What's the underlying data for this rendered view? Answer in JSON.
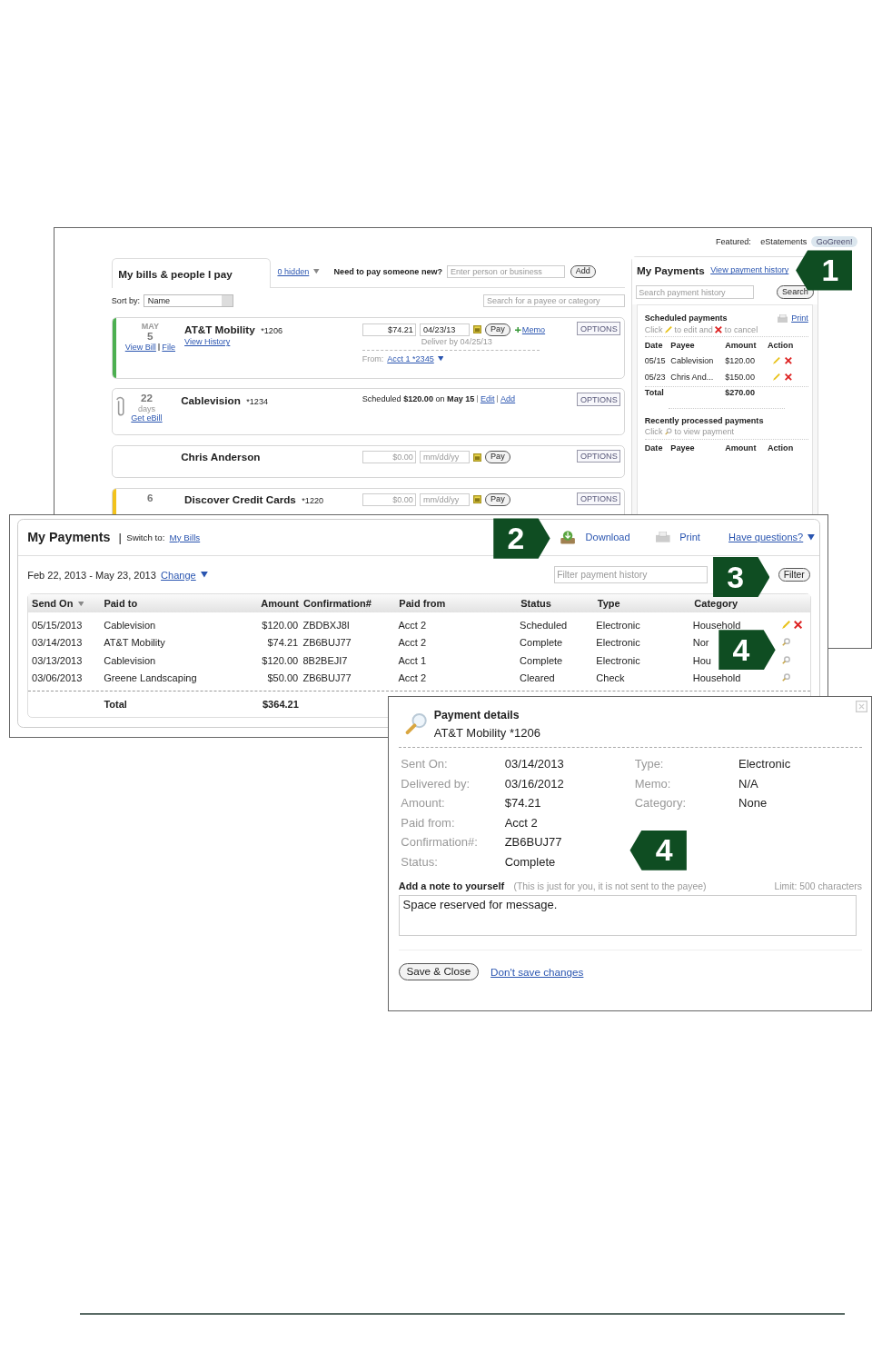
{
  "back_window": {
    "featured": {
      "label": "Featured:",
      "name": "eStatements",
      "badge": "GoGreen!"
    },
    "bills": {
      "title": "My bills & people I pay",
      "hidden_link": "0 hidden",
      "new_payee_label": "Need to pay someone new?",
      "new_payee_placeholder": "Enter person or business",
      "add_button": "Add",
      "sort_label": "Sort by:",
      "sort_value": "Name",
      "search_placeholder": "Search for a payee or category",
      "rows": [
        {
          "color": "#4caf50",
          "attachment": false,
          "month": "MAY",
          "day": "5",
          "links": [
            "View Bill",
            "File"
          ],
          "name": "AT&T Mobility",
          "account": "*1206",
          "sub_link": "View History",
          "amount": "$74.21",
          "date": "04/23/13",
          "deliver": "Deliver by 04/25/13",
          "pay": "Pay",
          "memo": "Memo",
          "from_label": "From:",
          "from_link": "Acct 1 *2345",
          "options": "OPTIONS"
        },
        {
          "attachment": true,
          "day": "22",
          "unit": "days",
          "link": "Get eBill",
          "name": "Cablevision",
          "account": "*1234",
          "scheduled": "Scheduled **$120.00** on **May 15**",
          "actions": [
            "Edit",
            "Add"
          ],
          "options": "OPTIONS"
        },
        {
          "attachment": false,
          "name": "Chris Anderson",
          "amount_placeholder": "$0.00",
          "date_placeholder": "mm/dd/yy",
          "pay": "Pay",
          "options": "OPTIONS"
        },
        {
          "color": "#f2c21b",
          "attachment": false,
          "day": "6",
          "name": "Discover Credit Cards",
          "account": "*1220",
          "amount_placeholder": "$0.00",
          "date_placeholder": "mm/dd/yy",
          "pay": "Pay",
          "options": "OPTIONS"
        }
      ]
    },
    "payments": {
      "title": "My Payments",
      "history_link": "View payment history",
      "search_placeholder": "Search payment history",
      "search_button": "Search",
      "scheduled": {
        "title": "Scheduled payments",
        "print": "Print",
        "hint": [
          "Click",
          "to edit and",
          "to cancel"
        ],
        "columns": [
          "Date",
          "Payee",
          "Amount",
          "Action"
        ],
        "rows": [
          {
            "date": "05/15",
            "payee": "Cablevision",
            "amount": "$120.00"
          },
          {
            "date": "05/23",
            "payee": "Chris And...",
            "amount": "$150.00"
          }
        ],
        "total_label": "Total",
        "total": "$270.00"
      },
      "recent": {
        "title": "Recently processed payments",
        "hint": [
          "Click",
          "to view payment"
        ],
        "columns": [
          "Date",
          "Payee",
          "Amount",
          "Action"
        ]
      }
    }
  },
  "payments_window": {
    "title": "My Payments",
    "separator": "|",
    "switch_label": "Switch to:",
    "switch_link": "My Bills",
    "download": "Download",
    "print": "Print",
    "help_link": "Have questions?",
    "range": "Feb 22, 2013 - May 23, 2013",
    "change_link": "Change",
    "filter_placeholder": "Filter payment history",
    "filter_button": "Filter",
    "columns": [
      "Send On",
      "Paid to",
      "Amount",
      "Confirmation#",
      "Paid from",
      "Status",
      "Type",
      "Category"
    ],
    "rows": [
      {
        "send_on": "05/15/2013",
        "paid_to": "Cablevision",
        "amount": "$120.00",
        "confirmation": "ZBDBXJ8I",
        "paid_from": "Acct 2",
        "status": "Scheduled",
        "type": "Electronic",
        "category": "Household",
        "editable": true
      },
      {
        "send_on": "03/14/2013",
        "paid_to": "AT&T Mobility",
        "amount": "$74.21",
        "confirmation": "ZB6BUJ77",
        "paid_from": "Acct 2",
        "status": "Complete",
        "type": "Electronic",
        "category": "Nor",
        "editable": false
      },
      {
        "send_on": "03/13/2013",
        "paid_to": "Cablevision",
        "amount": "$120.00",
        "confirmation": "8B2BEJI7",
        "paid_from": "Acct 1",
        "status": "Complete",
        "type": "Electronic",
        "category": "Hou",
        "editable": false
      },
      {
        "send_on": "03/06/2013",
        "paid_to": "Greene Landscaping",
        "amount": "$50.00",
        "confirmation": "ZB6BUJ77",
        "paid_from": "Acct 2",
        "status": "Cleared",
        "type": "Check",
        "category": "Household",
        "editable": false
      }
    ],
    "total_label": "Total",
    "total": "$364.21"
  },
  "details": {
    "title": "Payment details",
    "subtitle": "AT&T Mobility *1206",
    "fields": [
      {
        "label": "Sent On:",
        "value": "03/14/2013"
      },
      {
        "label": "Type:",
        "value": "Electronic"
      },
      {
        "label": "Delivered by:",
        "value": "03/16/2012"
      },
      {
        "label": "Memo:",
        "value": "N/A"
      },
      {
        "label": "Amount:",
        "value": "$74.21"
      },
      {
        "label": "Category:",
        "value": "None"
      },
      {
        "label": "Paid from:",
        "value": "Acct 2"
      },
      {
        "label": "Confirmation#:",
        "value": "ZB6BUJ77"
      },
      {
        "label": "Status:",
        "value": "Complete"
      }
    ],
    "note_label": "Add a note to yourself",
    "note_hint": "(This is just for you, it is not sent to the payee)",
    "note_limit": "Limit: 500 characters",
    "note": "Space reserved for message.",
    "save_button": "Save & Close",
    "discard_link": "Don't save changes"
  },
  "callouts": [
    {
      "number": "1",
      "points_left": true
    },
    {
      "number": "2",
      "points_left": false
    },
    {
      "number": "3",
      "points_left": false
    },
    {
      "number": "4",
      "points_left": false
    },
    {
      "number": "4",
      "points_left": true
    }
  ]
}
